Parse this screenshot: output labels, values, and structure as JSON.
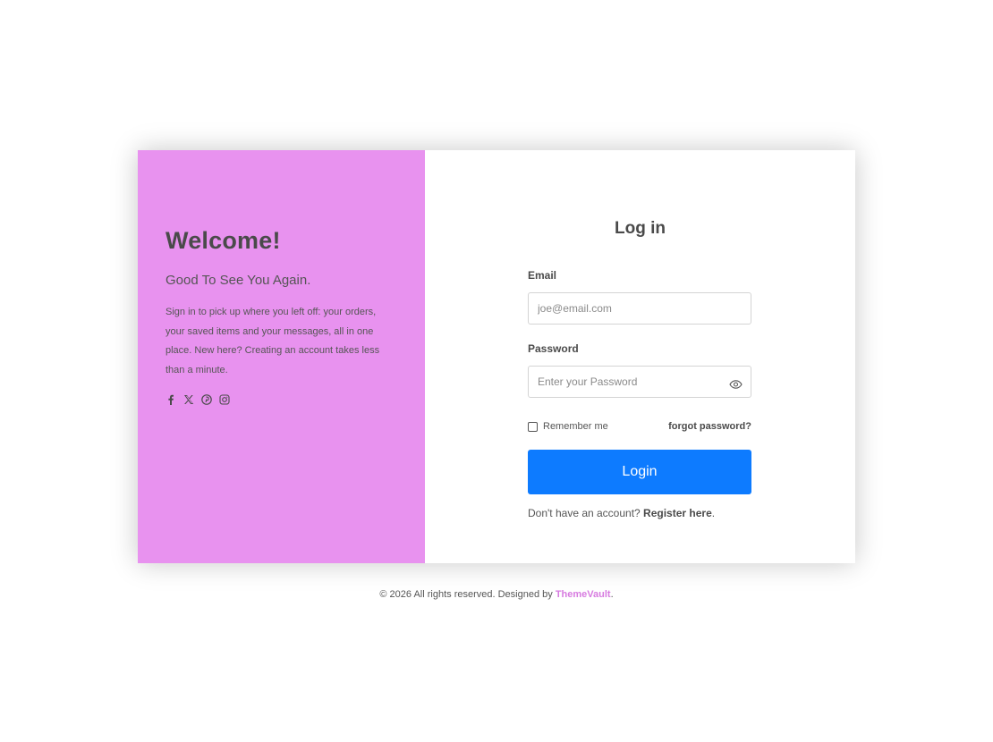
{
  "welcome": {
    "title": "Welcome!",
    "subtitle": "Good To See You Again.",
    "description": "Sign in to pick up where you left off: your orders, your saved items and your messages, all in one place. New here? Creating an account takes less than a minute.",
    "background_color": "#e892ef"
  },
  "socials": [
    "facebook-icon",
    "x-twitter-icon",
    "pinterest-icon",
    "instagram-icon"
  ],
  "login": {
    "title": "Log in",
    "email_label": "Email",
    "email_placeholder": "joe@email.com",
    "email_value": "",
    "password_label": "Password",
    "password_placeholder": "Enter your Password",
    "password_value": "",
    "remember_label": "Remember me",
    "remember_checked": false,
    "forgot_label": "forgot password?",
    "button_label": "Login",
    "button_color": "#0d7bff",
    "register_prompt": "Don't have an account? ",
    "register_link": "Register here",
    "register_suffix": "."
  },
  "footer": {
    "text": "© 2026 All rights reserved. Designed by ",
    "brand": "ThemeVault",
    "suffix": ".",
    "brand_color": "#d77be0"
  }
}
